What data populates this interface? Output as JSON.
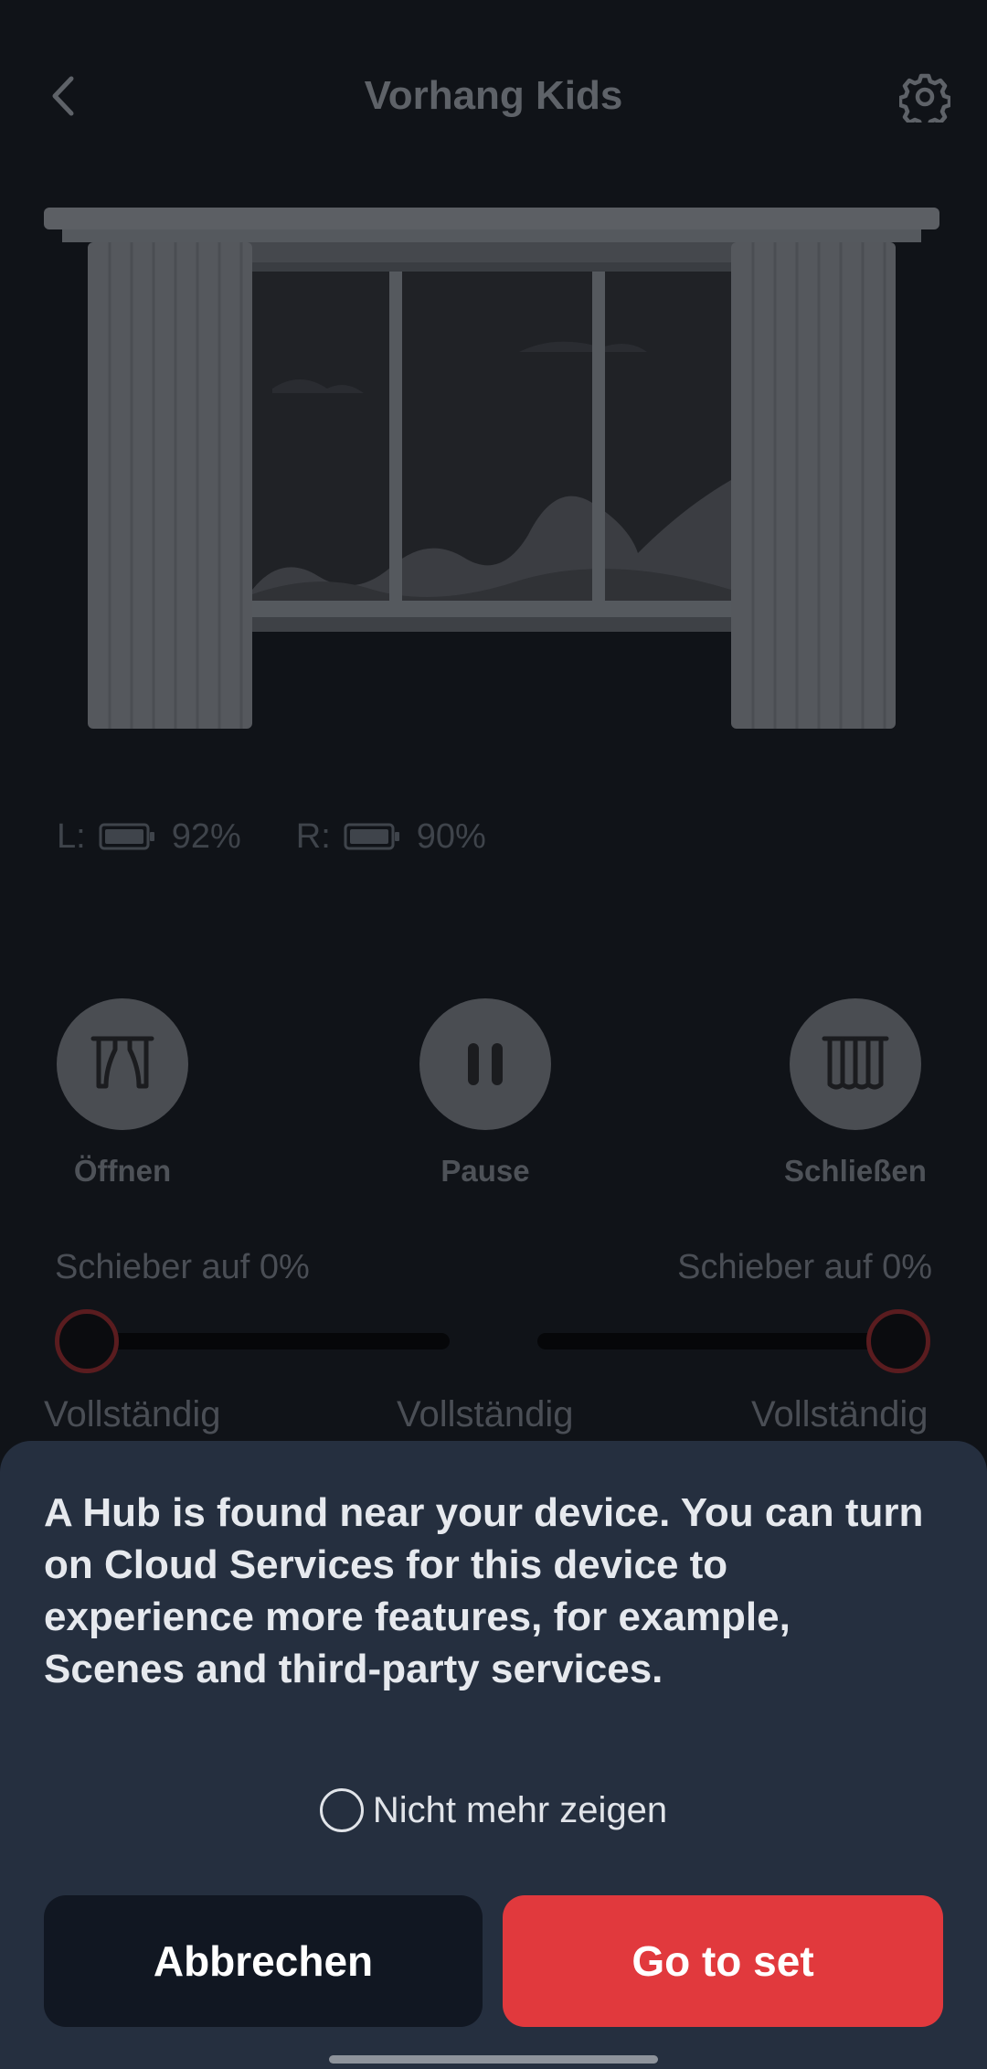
{
  "header": {
    "title": "Vorhang Kids",
    "back_icon": "chevron-left-icon",
    "settings_icon": "gear-icon"
  },
  "battery": {
    "left_label": "L:",
    "left_value": "92%",
    "right_label": "R:",
    "right_value": "90%"
  },
  "controls": {
    "open_label": "Öffnen",
    "pause_label": "Pause",
    "close_label": "Schließen"
  },
  "sliders": {
    "left_caption": "Schieber auf 0%",
    "right_caption": "Schieber auf 0%",
    "left_value_percent": 0,
    "right_value_percent": 0,
    "label_left": "Vollständig",
    "label_center": "Vollständig",
    "label_right": "Vollständig"
  },
  "sheet": {
    "message": "A Hub is found near your device. You can turn on Cloud Services for this device to experience more features, for example, Scenes and third-party services.",
    "dont_show_label": "Nicht mehr zeigen",
    "cancel_label": "Abbrechen",
    "confirm_label": "Go to set"
  },
  "colors": {
    "background": "#101318",
    "sheet": "#252f3f",
    "accent": "#e1393d",
    "cancel_button": "#111722"
  }
}
